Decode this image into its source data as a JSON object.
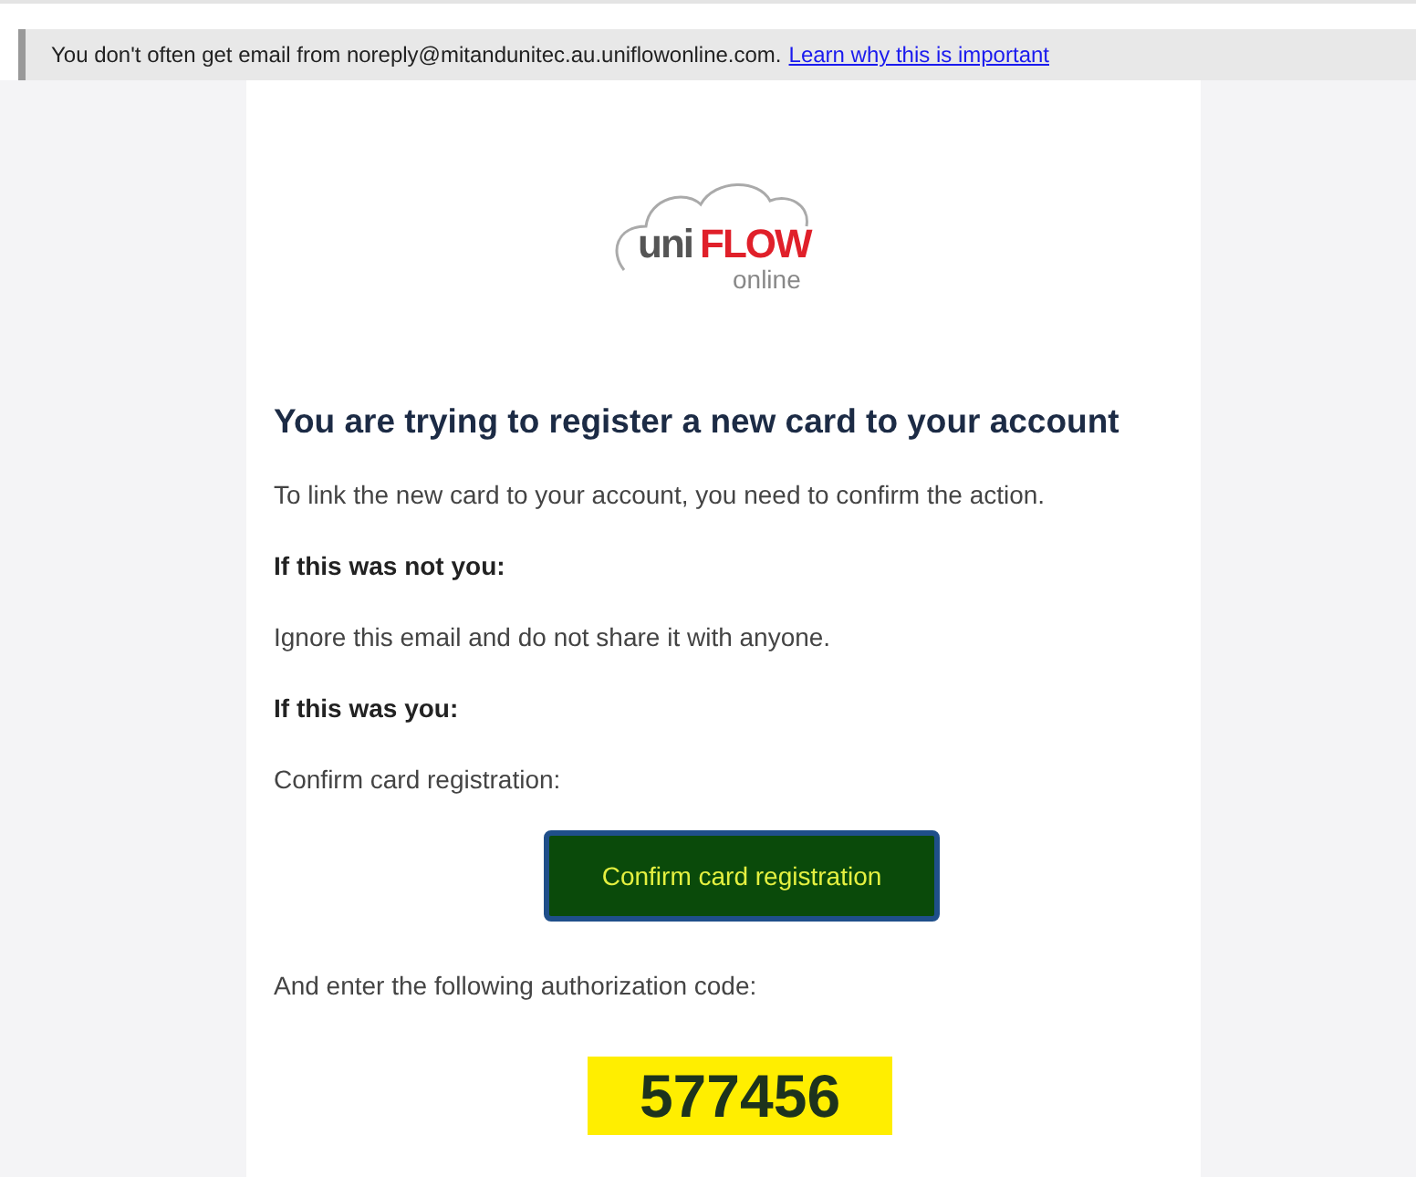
{
  "notice": {
    "text": "You don't often get email from noreply@mitandunitec.au.uniflowonline.com.",
    "link": "Learn why this is important"
  },
  "logo": {
    "prefix": "uni",
    "brand": "FLOW",
    "suffix": "online"
  },
  "heading": "You are trying to register a new card to your account",
  "blocks": [
    {
      "kind": "text",
      "text": "To link the new card to your account, you need to confirm the action."
    },
    {
      "kind": "bold",
      "text": "If this was not you:"
    },
    {
      "kind": "text",
      "text": "Ignore this email and do not share it with anyone."
    },
    {
      "kind": "bold",
      "text": "If this was you:"
    },
    {
      "kind": "text",
      "text": "Confirm card registration:"
    },
    {
      "kind": "button",
      "text": "Confirm card registration"
    },
    {
      "kind": "text",
      "text": "And enter the following authorization code:"
    },
    {
      "kind": "code",
      "text": "577456"
    }
  ]
}
